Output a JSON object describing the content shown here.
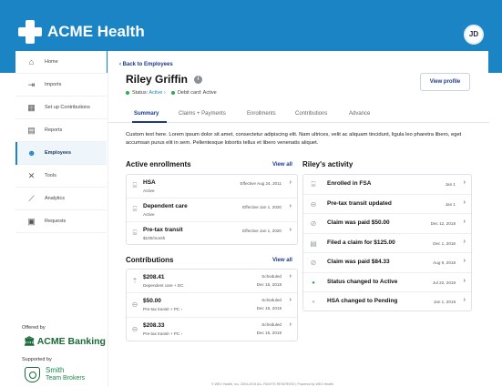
{
  "app": {
    "brand": "ACME Health",
    "avatar_initials": "JD",
    "brand_color": "#1a84c4"
  },
  "sidebar": {
    "items": [
      {
        "label": "Home",
        "icon": "home-icon",
        "glyph": "⌂"
      },
      {
        "label": "Imports",
        "icon": "import-icon",
        "glyph": "⇥"
      },
      {
        "label": "Set up Contributions",
        "icon": "calendar-icon",
        "glyph": "▦"
      },
      {
        "label": "Reports",
        "icon": "report-icon",
        "glyph": "▤"
      },
      {
        "label": "Employees",
        "icon": "people-icon",
        "glyph": "☻"
      },
      {
        "label": "Tools",
        "icon": "tools-icon",
        "glyph": "✕"
      },
      {
        "label": "Analytics",
        "icon": "analytics-icon",
        "glyph": "⟋"
      },
      {
        "label": "Requests",
        "icon": "requests-icon",
        "glyph": "▣"
      }
    ],
    "active": "Employees",
    "offered_by": "Offered by",
    "bank_name": "ACME Banking",
    "supported_by": "Supported by",
    "broker_name": "Smith",
    "broker_sub": "Team Brokers"
  },
  "profile": {
    "back_label": "‹ Back to Employees",
    "name": "Riley Griffin",
    "status_label": "Status:",
    "status_value": "Active ›",
    "debit_label": "Debit card: Active",
    "view_profile_label": "View profile"
  },
  "tabs": [
    "Summary",
    "Claims + Payments",
    "Enrollments",
    "Contributions",
    "Advance"
  ],
  "description": "Custom text here. Lorem ipsum dolor sit amet, consectetur adipiscing elit. Nam ultrices, velit ac aliquam tincidunt, ligula leo pharetra libero, eget accumsan purus elit in sem. Pellentesque lobortis tellus et libero venenatis aliquet.",
  "enrollments": {
    "title": "Active enrollments",
    "view_all": "View all",
    "items": [
      {
        "title": "HSA",
        "sub": "Active",
        "right": "Effective Aug 24, 2011",
        "icon": "bank-icon"
      },
      {
        "title": "Dependent care",
        "sub": "Active",
        "right": "Effective Jan 1, 2020",
        "icon": "bank-icon"
      },
      {
        "title": "Pre-tax transit",
        "sub": "$100/month",
        "right": "Effective Jan 1, 2020",
        "icon": "bank-icon"
      }
    ]
  },
  "contributions": {
    "title": "Contributions",
    "view_all": "View all",
    "items": [
      {
        "amount": "$208.41",
        "sub": "Dependent care + DC",
        "status": "Scheduled",
        "date": "Dec 15, 2018",
        "icon": "transfer-icon"
      },
      {
        "amount": "$50.00",
        "sub": "Pre-tax transit + PC ›",
        "status": "Scheduled",
        "date": "Dec 15, 2018",
        "icon": "bus-icon"
      },
      {
        "amount": "$208.33",
        "sub": "Pre-tax transit + PC ›",
        "status": "Scheduled",
        "date": "Dec 15, 2018",
        "icon": "bus-icon"
      }
    ]
  },
  "activity": {
    "title": "Riley's activity",
    "items": [
      {
        "title": "Enrolled in FSA",
        "date": "Jan 1",
        "icon": "bank-icon",
        "glyph": "⌸"
      },
      {
        "title": "Pre-tax transit updated",
        "date": "Jan 1",
        "icon": "bus-icon",
        "glyph": "⊖"
      },
      {
        "title": "Claim was paid $50.00",
        "date": "Dec 12, 2018",
        "icon": "check-circle-icon",
        "glyph": "⊘"
      },
      {
        "title": "Filed a claim for $125.00",
        "date": "Dec 1, 2018",
        "icon": "document-icon",
        "glyph": "▤"
      },
      {
        "title": "Claim was paid $84.33",
        "date": "Aug 9, 2018",
        "icon": "check-circle-icon",
        "glyph": "⊘"
      },
      {
        "title": "Status changed to Active",
        "date": "Jul 22, 2018",
        "icon": "green-dot-icon",
        "glyph": "●"
      },
      {
        "title": "HSA changed to Pending",
        "date": "Jan 1, 2018",
        "icon": "gray-dot-icon",
        "glyph": "●"
      }
    ]
  },
  "footer": "© WEX Health, Inc. 2004-2019 ALL RIGHTS RESERVED | Powered by WEX Health"
}
